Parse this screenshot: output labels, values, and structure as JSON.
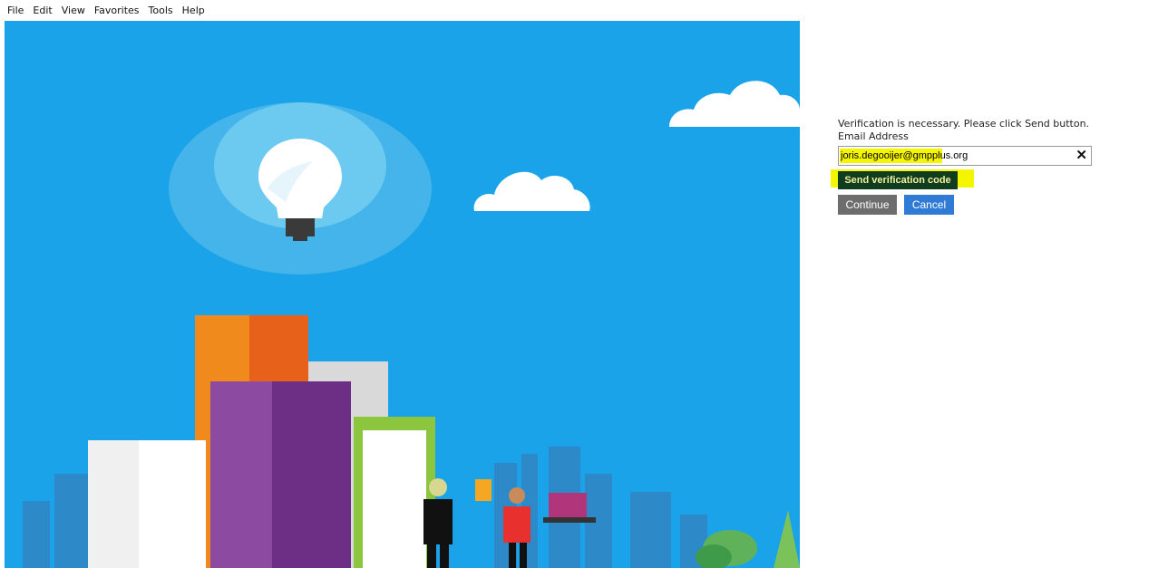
{
  "menu": {
    "items": [
      {
        "label": "File"
      },
      {
        "label": "Edit"
      },
      {
        "label": "View"
      },
      {
        "label": "Favorites"
      },
      {
        "label": "Tools"
      },
      {
        "label": "Help"
      }
    ]
  },
  "verification": {
    "message": "Verification is necessary. Please click Send button.",
    "email_label": "Email Address",
    "email_value": "joris.degooijer@gmpplus.org",
    "clear_icon": "close-icon",
    "send_label": "Send verification code",
    "continue_label": "Continue",
    "cancel_label": "Cancel"
  },
  "colors": {
    "hero_sky": "#1aa3e8",
    "highlight": "#f5f500",
    "send_button": "#0f3d1d",
    "continue_button": "#6d6d6d",
    "cancel_button": "#2f7bd5"
  }
}
